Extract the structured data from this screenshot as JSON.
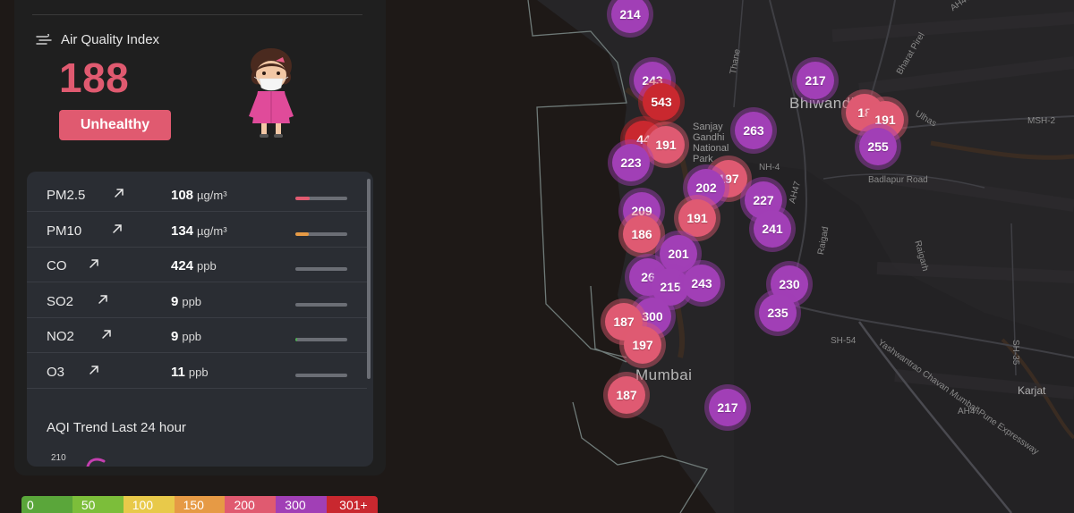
{
  "panel": {
    "title": "Air Quality Index",
    "aqi": "188",
    "status": "Unhealthy",
    "pollutants": [
      {
        "name": "PM2.5",
        "value": "108",
        "unit": "µg/m³",
        "level": 0.28,
        "color": "#e05a70"
      },
      {
        "name": "PM10",
        "value": "134",
        "unit": "µg/m³",
        "level": 0.25,
        "color": "#e69a45"
      },
      {
        "name": "CO",
        "value": "424",
        "unit": "ppb",
        "level": 0,
        "color": "#6b6e75"
      },
      {
        "name": "SO2",
        "value": "9",
        "unit": "ppb",
        "level": 0,
        "color": "#6b6e75"
      },
      {
        "name": "NO2",
        "value": "9",
        "unit": "ppb",
        "level": 0.03,
        "color": "#4caf50"
      },
      {
        "name": "O3",
        "value": "11",
        "unit": "ppb",
        "level": 0,
        "color": "#6b6e75"
      }
    ],
    "trend_title": "AQI Trend Last 24 hour",
    "trend_tick": "210"
  },
  "legend": [
    {
      "label": "0",
      "color": "#5aa63a"
    },
    {
      "label": "50",
      "color": "#7cbe3a"
    },
    {
      "label": "100",
      "color": "#e8c94a"
    },
    {
      "label": "150",
      "color": "#e69a45"
    },
    {
      "label": "200",
      "color": "#e05a70"
    },
    {
      "label": "300",
      "color": "#a13fb6"
    },
    {
      "label": "301+",
      "color": "#c9282f"
    }
  ],
  "map": {
    "labels": {
      "bhiwandi": "Bhiwandi",
      "mumbai": "Mumbai",
      "karjat": "Karjat",
      "sanjay": "Sanjay",
      "gandhi": "Gandhi",
      "national": "National",
      "park": "Park",
      "nh4": "NH-4",
      "msh2": "MSH-2",
      "sh54": "SH-54",
      "sh35": "SH-35",
      "ah47": "AH47",
      "ah47b": "AH47",
      "badlapur": "Badlapur Road",
      "expressway": "Yashwantrao Chavan Mumbai-Pune Expressway",
      "raigad": "Raigad",
      "raigarh": "Raigarh",
      "thane": "Thane",
      "bharat": "Bharat Pirel",
      "ulhas": "Ulhas",
      "ah47c": "AH47"
    },
    "markers": [
      {
        "v": "214",
        "c": "purple"
      },
      {
        "v": "243",
        "c": "purple"
      },
      {
        "v": "543",
        "c": "red"
      },
      {
        "v": "44",
        "c": "red"
      },
      {
        "v": "191",
        "c": "pink"
      },
      {
        "v": "223",
        "c": "purple"
      },
      {
        "v": "263",
        "c": "purple"
      },
      {
        "v": "217",
        "c": "purple"
      },
      {
        "v": "18",
        "c": "pink"
      },
      {
        "v": "191",
        "c": "pink"
      },
      {
        "v": "255",
        "c": "purple"
      },
      {
        "v": "197",
        "c": "pink"
      },
      {
        "v": "202",
        "c": "purple"
      },
      {
        "v": "227",
        "c": "purple"
      },
      {
        "v": "209",
        "c": "purple"
      },
      {
        "v": "191",
        "c": "pink"
      },
      {
        "v": "241",
        "c": "purple"
      },
      {
        "v": "186",
        "c": "pink"
      },
      {
        "v": "201",
        "c": "purple"
      },
      {
        "v": "26",
        "c": "purple"
      },
      {
        "v": "215",
        "c": "purple"
      },
      {
        "v": "243",
        "c": "purple"
      },
      {
        "v": "230",
        "c": "purple"
      },
      {
        "v": "300",
        "c": "purple"
      },
      {
        "v": "235",
        "c": "purple"
      },
      {
        "v": "187",
        "c": "pink"
      },
      {
        "v": "197",
        "c": "pink"
      },
      {
        "v": "187",
        "c": "pink"
      },
      {
        "v": "217",
        "c": "purple"
      }
    ]
  }
}
